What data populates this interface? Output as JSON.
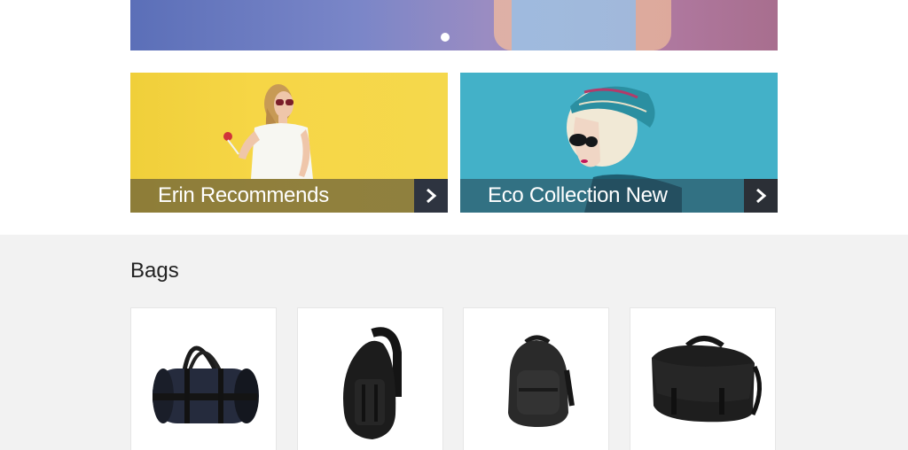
{
  "hero": {
    "slide_indicator": "active-slide-dot"
  },
  "promos": [
    {
      "label": "Erin Recommends",
      "bg": "#f5d84c",
      "arrow_icon": "chevron-right-icon"
    },
    {
      "label": "Eco Collection New",
      "bg": "#43b1c8",
      "arrow_icon": "chevron-right-icon"
    }
  ],
  "bags": {
    "title": "Bags",
    "products": [
      {
        "name": "duffle-bag"
      },
      {
        "name": "sling-backpack"
      },
      {
        "name": "backpack"
      },
      {
        "name": "messenger-bag"
      }
    ]
  },
  "colors": {
    "section_bg": "#f2f2f2",
    "caption_overlay": "#504b37",
    "arrow_bg": "#2e3440"
  }
}
